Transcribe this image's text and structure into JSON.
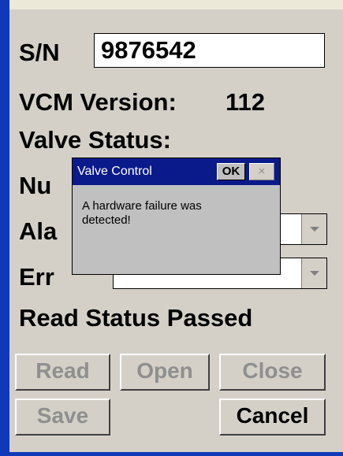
{
  "form": {
    "sn_label": "S/N",
    "sn_value": "9876542",
    "vcm_version_label": "VCM Version:",
    "vcm_version_value": "112",
    "valve_status_label": "Valve Status:",
    "num_label_partial": "Nu",
    "alarm_label_partial": "Ala",
    "error_label_partial": "Err",
    "read_status": "Read Status Passed"
  },
  "buttons": {
    "read": "Read",
    "open": "Open",
    "close": "Close",
    "save": "Save",
    "cancel": "Cancel"
  },
  "dialog": {
    "title": "Valve Control",
    "ok_label": "OK",
    "close_glyph": "×",
    "message_line1": "A hardware failure was",
    "message_line2": "detected!"
  },
  "icons": {
    "combo_arrow": "chevron-down-icon",
    "dialog_close": "close-icon"
  },
  "colors": {
    "window_border": "#0f39b8",
    "dialog_title_bar": "#0a1a8a",
    "background": "#d4d0c8"
  }
}
